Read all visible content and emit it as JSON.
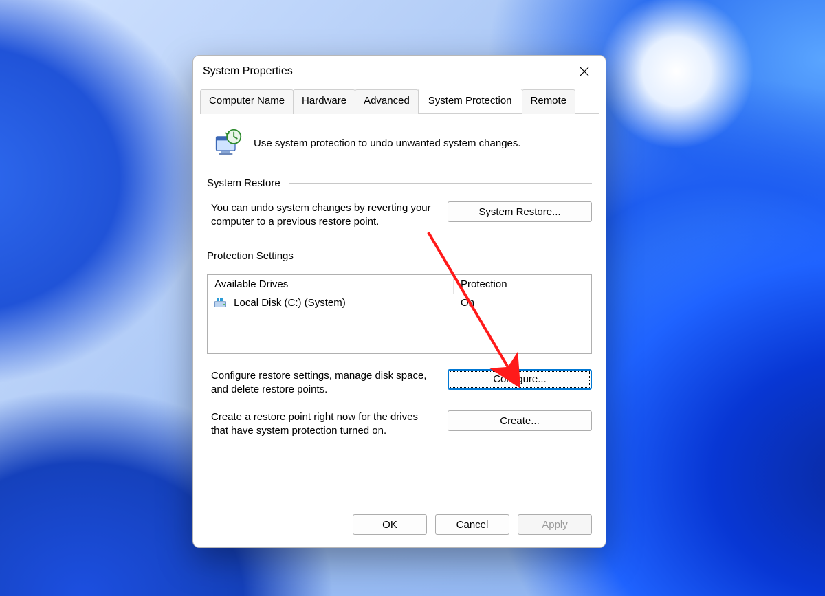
{
  "window": {
    "title": "System Properties"
  },
  "tabs": [
    {
      "label": "Computer Name",
      "active": false
    },
    {
      "label": "Hardware",
      "active": false
    },
    {
      "label": "Advanced",
      "active": false
    },
    {
      "label": "System Protection",
      "active": true
    },
    {
      "label": "Remote",
      "active": false
    }
  ],
  "intro_text": "Use system protection to undo unwanted system changes.",
  "sections": {
    "restore": {
      "header": "System Restore",
      "desc": "You can undo system changes by reverting your computer to a previous restore point.",
      "button": "System Restore..."
    },
    "settings": {
      "header": "Protection Settings",
      "columns": {
        "drives": "Available Drives",
        "protection": "Protection"
      },
      "rows": [
        {
          "drive": "Local Disk (C:) (System)",
          "protection": "On"
        }
      ],
      "configure_desc": "Configure restore settings, manage disk space, and delete restore points.",
      "configure_button": "Configure...",
      "create_desc": "Create a restore point right now for the drives that have system protection turned on.",
      "create_button": "Create..."
    }
  },
  "footer": {
    "ok": "OK",
    "cancel": "Cancel",
    "apply": "Apply"
  }
}
